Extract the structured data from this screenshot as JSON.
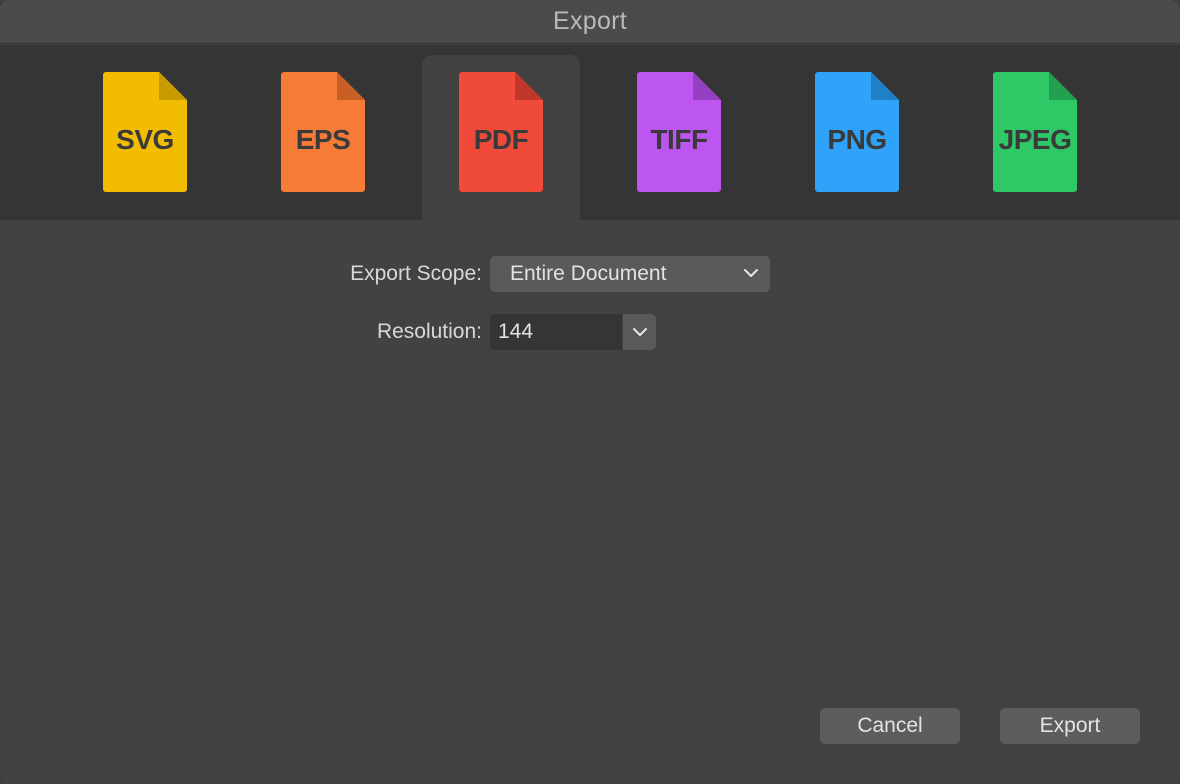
{
  "window": {
    "title": "Export"
  },
  "formats": [
    {
      "id": "svg",
      "label": "SVG",
      "color": "#f2bd00",
      "fold": "#c99a00",
      "selected": false
    },
    {
      "id": "eps",
      "label": "EPS",
      "color": "#f57b36",
      "fold": "#c75f26",
      "selected": false
    },
    {
      "id": "pdf",
      "label": "PDF",
      "color": "#f04a3a",
      "fold": "#c0382b",
      "selected": true
    },
    {
      "id": "tiff",
      "label": "TIFF",
      "color": "#bd55f0",
      "fold": "#9440c0",
      "selected": false
    },
    {
      "id": "png",
      "label": "PNG",
      "color": "#2ea3f9",
      "fold": "#1f80c8",
      "selected": false
    },
    {
      "id": "jpeg",
      "label": "JPEG",
      "color": "#2ec966",
      "fold": "#21a04f",
      "selected": false
    }
  ],
  "form": {
    "scope_label": "Export Scope:",
    "scope_value": "Entire Document",
    "resolution_label": "Resolution:",
    "resolution_value": "144"
  },
  "buttons": {
    "cancel": "Cancel",
    "export": "Export"
  },
  "icons": {
    "scope_dropdown": "chevron-down-icon",
    "resolution_dropdown": "chevron-down-icon"
  }
}
